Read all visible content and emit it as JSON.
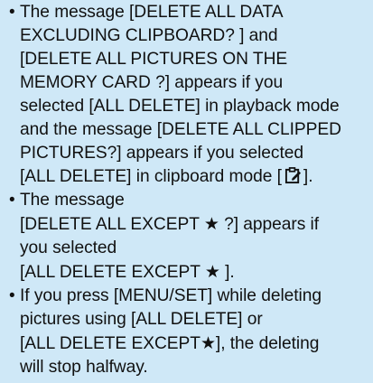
{
  "notes": [
    {
      "bullet": "•",
      "line1": "The message [DELETE ALL DATA",
      "line2": "EXCLUDING CLIPBOARD? ] and",
      "line3": "[DELETE ALL PICTURES ON THE",
      "line4": "MEMORY CARD ?] appears if you",
      "line5": "selected [ALL DELETE] in playback mode",
      "line6": "and the message [DELETE ALL CLIPPED",
      "line7": "PICTURES?] appears if you selected",
      "line8_before_icon": "[ALL DELETE] in clipboard mode [",
      "line8_after_icon": "].",
      "icon": "clipboard-mode-icon"
    },
    {
      "bullet": "•",
      "line1": "The message",
      "line2_before_star": "[DELETE ALL EXCEPT ",
      "line2_after_star": " ?] appears if",
      "line3": "you selected",
      "line4_before_star": "[ALL DELETE EXCEPT ",
      "line4_after_star": " ].",
      "star": "★"
    },
    {
      "bullet": "•",
      "line1": "If you press [MENU/SET] while deleting",
      "line2": "pictures using [ALL DELETE] or",
      "line3_before_star": "[ALL DELETE EXCEPT",
      "line3_after_star": "], the deleting",
      "line4": "will stop halfway.",
      "star": "★"
    }
  ],
  "colors": {
    "background": "#cfe8f7",
    "text": "#111111"
  }
}
